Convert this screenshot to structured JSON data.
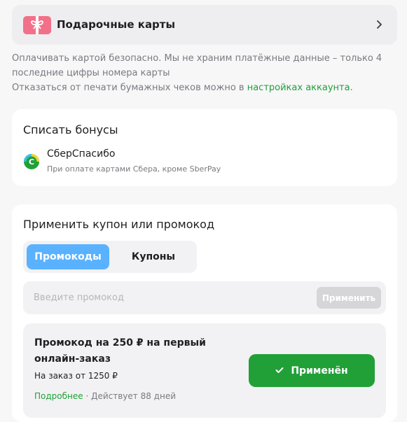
{
  "gift_cards": {
    "title": "Подарочные карты",
    "icon": "gift-icon",
    "chevron": "chevron-right-icon"
  },
  "info": {
    "line1": "Оплачивать картой безопасно. Мы не храним платёжные данные – только 4 последние цифры номера карты",
    "line2_prefix": "Отказаться от печати бумажных чеков можно в ",
    "line2_link": "настройках аккаунта",
    "line2_suffix": "."
  },
  "bonus": {
    "title": "Списать бонусы",
    "program_name": "СберСпасибо",
    "program_desc": "При оплате картами Сбера, кроме SberPay",
    "logo_letter": "С"
  },
  "promo": {
    "title": "Применить купон или промокод",
    "tabs": [
      {
        "label": "Промокоды",
        "active": true
      },
      {
        "label": "Купоны",
        "active": false
      }
    ],
    "input_placeholder": "Введите промокод",
    "apply_label": "Применить",
    "coupon": {
      "title": "Промокод на 250 ₽ на первый онлайн-заказ",
      "condition": "На заказ от 1250 ₽",
      "more_label": "Подробнее",
      "separator": " · ",
      "validity": "Действует 88 дней",
      "applied_label": "Применён",
      "applied_icon": "check-icon"
    }
  },
  "colors": {
    "accent_green": "#21a038",
    "accent_blue": "#5ab2ff",
    "gift_pink": "#f2708a",
    "muted_text": "#7a7a80"
  }
}
